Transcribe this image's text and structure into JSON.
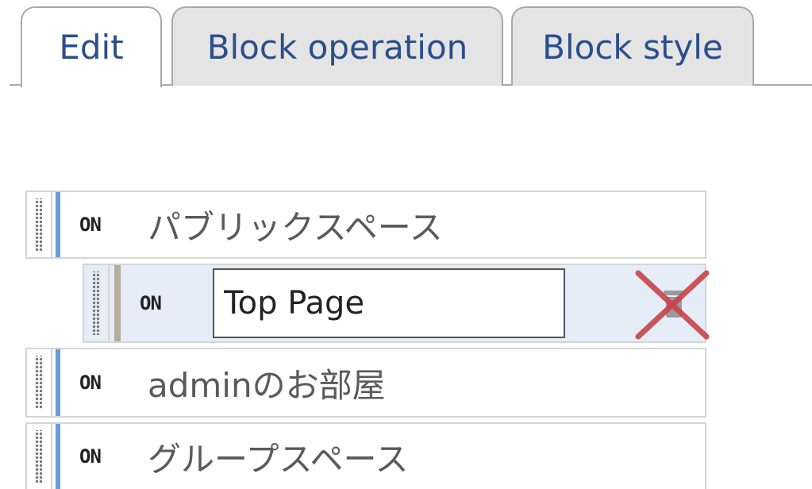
{
  "tabs": [
    {
      "label": "Edit",
      "active": true
    },
    {
      "label": "Block operation",
      "active": false
    },
    {
      "label": "Block style",
      "active": false
    }
  ],
  "blocks": [
    {
      "status": "ON",
      "name": "パブリックスペース",
      "editing": false
    },
    {
      "status": "ON",
      "name": "Top Page",
      "editing": true
    },
    {
      "status": "ON",
      "name": "adminのお部屋",
      "editing": false
    },
    {
      "status": "ON",
      "name": "グループスペース",
      "editing": false
    }
  ],
  "colors": {
    "tab_text": "#2b4e8c",
    "accent_bar": "#6a9bd8",
    "editing_row_bg": "#e5edf8",
    "delete_x": "#c9434a"
  },
  "icons": {
    "drag_handle": "drag-handle-icon",
    "trash": "trash-icon",
    "delete": "delete-x-icon"
  }
}
